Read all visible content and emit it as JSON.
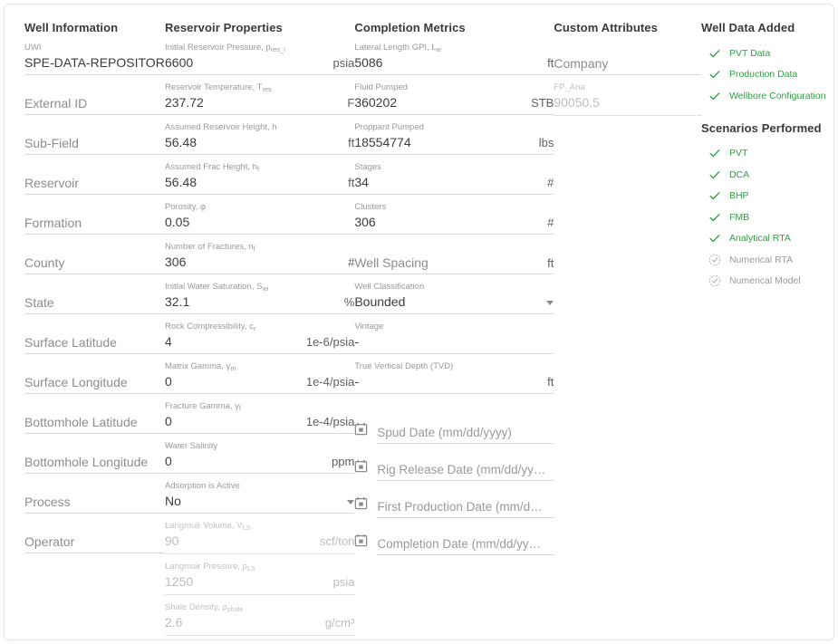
{
  "colors": {
    "green": "#2f9e41",
    "gray": "#9b9b9b",
    "label": "#9a9a9a",
    "value": "#3c3c3c",
    "underline": "#d8d8d8"
  },
  "well_information": {
    "title": "Well Information",
    "fields": [
      {
        "label": "UWI",
        "value": "SPE-DATA-REPOSITORY-D",
        "unit": "",
        "empty": false,
        "disabled": false
      },
      {
        "label": "External ID",
        "value": "",
        "unit": "",
        "empty": true,
        "disabled": false
      },
      {
        "label": "Sub-Field",
        "value": "",
        "unit": "",
        "empty": true,
        "disabled": false
      },
      {
        "label": "Reservoir",
        "value": "",
        "unit": "",
        "empty": true,
        "disabled": false
      },
      {
        "label": "Formation",
        "value": "",
        "unit": "",
        "empty": true,
        "disabled": false
      },
      {
        "label": "County",
        "value": "",
        "unit": "",
        "empty": true,
        "disabled": false
      },
      {
        "label": "State",
        "value": "",
        "unit": "",
        "empty": true,
        "disabled": false
      },
      {
        "label": "Surface Latitude",
        "value": "",
        "unit": "",
        "empty": true,
        "disabled": false
      },
      {
        "label": "Surface Longitude",
        "value": "",
        "unit": "",
        "empty": true,
        "disabled": false
      },
      {
        "label": "Bottomhole Latitude",
        "value": "",
        "unit": "",
        "empty": true,
        "disabled": false
      },
      {
        "label": "Bottomhole Longitude",
        "value": "",
        "unit": "",
        "empty": true,
        "disabled": false
      },
      {
        "label": "Process",
        "value": "",
        "unit": "",
        "empty": true,
        "disabled": false
      },
      {
        "label": "Operator",
        "value": "",
        "unit": "",
        "empty": true,
        "disabled": false
      }
    ]
  },
  "reservoir_properties": {
    "title": "Reservoir Properties",
    "fields": [
      {
        "label": "Initial Reservoir Pressure, p",
        "sub": "res_i",
        "value": "6600",
        "unit": "psia",
        "empty": false,
        "disabled": false
      },
      {
        "label": "Reservoir Temperature, T",
        "sub": "res",
        "value": "237.72",
        "unit": "F",
        "empty": false,
        "disabled": false
      },
      {
        "label": "Assumed Reservoir Height, h",
        "sub": "",
        "value": "56.48",
        "unit": "ft",
        "empty": false,
        "disabled": false
      },
      {
        "label": "Assumed Frac Height, h",
        "sub": "f",
        "value": "56.48",
        "unit": "ft",
        "empty": false,
        "disabled": false
      },
      {
        "label": "Porosity, φ",
        "sub": "",
        "value": "0.05",
        "unit": "",
        "empty": false,
        "disabled": false
      },
      {
        "label": "Number of Fractures, n",
        "sub": "f",
        "value": "306",
        "unit": "#",
        "empty": false,
        "disabled": false
      },
      {
        "label": "Initial Water Saturation, S",
        "sub": "wi",
        "value": "32.1",
        "unit": "%",
        "empty": false,
        "disabled": false
      },
      {
        "label": "Rock Compressibility, c",
        "sub": "r",
        "value": "4",
        "unit": "1e-6/psia",
        "empty": false,
        "disabled": false
      },
      {
        "label": "Matrix Gamma, γ",
        "sub": "m",
        "value": "0",
        "unit": "1e-4/psia",
        "empty": false,
        "disabled": false
      },
      {
        "label": "Fracture Gamma, γ",
        "sub": "f",
        "value": "0",
        "unit": "1e-4/psia",
        "empty": false,
        "disabled": false
      },
      {
        "label": "Water Salinity",
        "sub": "",
        "value": "0",
        "unit": "ppm",
        "empty": false,
        "disabled": false
      },
      {
        "label": "Adsorption is Active",
        "sub": "",
        "value": "No",
        "unit": "",
        "empty": false,
        "disabled": false,
        "dropdown": true
      },
      {
        "label": "Langmuir Volume, V",
        "sub": "LS",
        "value": "90",
        "unit": "scf/ton",
        "empty": false,
        "disabled": true
      },
      {
        "label": "Langmuir Pressure, p",
        "sub": "LS",
        "value": "1250",
        "unit": "psia",
        "empty": false,
        "disabled": true
      },
      {
        "label": "Shale Density, ρ",
        "sub": "shale",
        "value": "2.6",
        "unit": "g/cm³",
        "empty": false,
        "disabled": true
      }
    ]
  },
  "completion_metrics": {
    "title": "Completion Metrics",
    "fields": [
      {
        "label": "Lateral Length GPI, L",
        "sub": "w",
        "value": "5086",
        "unit": "ft",
        "empty": false,
        "disabled": false
      },
      {
        "label": "Fluid Pumped",
        "sub": "",
        "value": "360202",
        "unit": "STB",
        "empty": false,
        "disabled": false
      },
      {
        "label": "Proppant Pumped",
        "sub": "",
        "value": "18554774",
        "unit": "lbs",
        "empty": false,
        "disabled": false
      },
      {
        "label": "Stages",
        "sub": "",
        "value": "34",
        "unit": "#",
        "empty": false,
        "disabled": false
      },
      {
        "label": "Clusters",
        "sub": "",
        "value": "306",
        "unit": "#",
        "empty": false,
        "disabled": false
      },
      {
        "label": "Well Spacing",
        "sub": "",
        "value": "",
        "unit": "ft",
        "empty": true,
        "disabled": false
      },
      {
        "label": "Well Classification",
        "sub": "",
        "value": "Bounded",
        "unit": "",
        "empty": false,
        "disabled": false,
        "dropdown": true
      },
      {
        "label": "Vintage",
        "sub": "",
        "value": "-",
        "unit": "",
        "empty": false,
        "disabled": false
      },
      {
        "label": "True Vertical Depth (TVD)",
        "sub": "",
        "value": "-",
        "unit": "ft",
        "empty": false,
        "disabled": false
      }
    ],
    "date_fields": [
      {
        "placeholder": "Spud Date (mm/dd/yyyy)",
        "icon": "calendar-icon"
      },
      {
        "placeholder": "Rig Release Date (mm/dd/yy…",
        "icon": "calendar-icon"
      },
      {
        "placeholder": "First Production Date (mm/d…",
        "icon": "calendar-icon"
      },
      {
        "placeholder": "Completion Date (mm/dd/yy…",
        "icon": "calendar-icon"
      }
    ]
  },
  "custom_attributes": {
    "title": "Custom Attributes",
    "fields": [
      {
        "label": "Company",
        "value": "",
        "unit": "",
        "empty": true,
        "disabled": false
      },
      {
        "label": "FP_Ana",
        "value": "90050.5",
        "unit": "",
        "empty": false,
        "disabled": true
      }
    ]
  },
  "well_data_added": {
    "title": "Well Data Added",
    "items": [
      {
        "label": "PVT Data",
        "state": "done",
        "icon": "check-icon"
      },
      {
        "label": "Production Data",
        "state": "done",
        "icon": "check-icon"
      },
      {
        "label": "Wellbore Configuration",
        "state": "done",
        "icon": "check-icon"
      }
    ]
  },
  "scenarios_performed": {
    "title": "Scenarios Performed",
    "items": [
      {
        "label": "PVT",
        "state": "done",
        "icon": "check-icon"
      },
      {
        "label": "DCA",
        "state": "done",
        "icon": "check-icon"
      },
      {
        "label": "BHP",
        "state": "done",
        "icon": "check-icon"
      },
      {
        "label": "FMB",
        "state": "done",
        "icon": "check-icon"
      },
      {
        "label": "Analytical RTA",
        "state": "done",
        "icon": "check-icon"
      },
      {
        "label": "Numerical RTA",
        "state": "pending",
        "icon": "dashed-circle-check-icon"
      },
      {
        "label": "Numerical Model",
        "state": "pending",
        "icon": "dashed-circle-check-icon"
      }
    ]
  }
}
